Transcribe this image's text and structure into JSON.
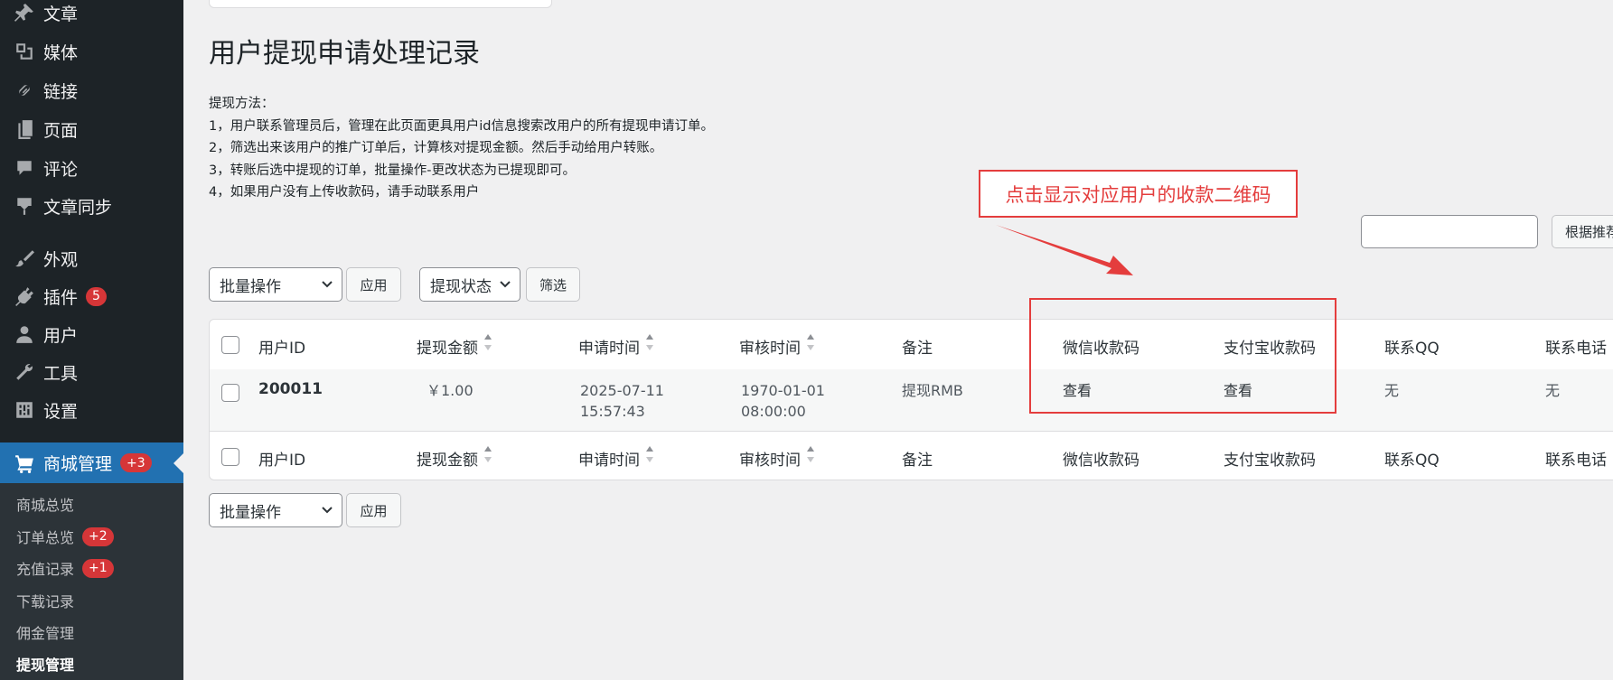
{
  "sidebar": {
    "items": [
      {
        "label": "文章",
        "icon": "pin-icon"
      },
      {
        "label": "媒体",
        "icon": "media-icon"
      },
      {
        "label": "链接",
        "icon": "link-icon"
      },
      {
        "label": "页面",
        "icon": "page-icon"
      },
      {
        "label": "评论",
        "icon": "comment-icon"
      },
      {
        "label": "文章同步",
        "icon": "sync-icon"
      },
      {
        "label": "外观",
        "icon": "brush-icon"
      },
      {
        "label": "插件",
        "icon": "plugin-icon",
        "badge": "5"
      },
      {
        "label": "用户",
        "icon": "user-icon"
      },
      {
        "label": "工具",
        "icon": "wrench-icon"
      },
      {
        "label": "设置",
        "icon": "settings-icon"
      }
    ],
    "active": {
      "label": "商城管理",
      "badge": "+3",
      "icon": "cart-icon"
    },
    "submenu": [
      {
        "label": "商城总览"
      },
      {
        "label": "订单总览",
        "badge": "+2"
      },
      {
        "label": "充值记录",
        "badge": "+1"
      },
      {
        "label": "下载记录"
      },
      {
        "label": "佣金管理"
      },
      {
        "label": "提现管理"
      }
    ]
  },
  "page": {
    "title": "用户提现申请处理记录",
    "instructions": [
      "提现方法：",
      "1，用户联系管理员后，管理在此页面更具用户id信息搜索改用户的所有提现申请订单。",
      "2，筛选出来该用户的推广订单后，计算核对提现金额。然后手动给用户转账。",
      "3，转账后选中提现的订单，批量操作-更改状态为已提现即可。",
      "4，如果用户没有上传收款码，请手动联系用户"
    ],
    "annotation": "点击显示对应用户的收款二维码",
    "search_button": "根据推荐人ID搜索"
  },
  "toolbar": {
    "bulk_action": "批量操作",
    "apply": "应用",
    "status_filter": "提现状态",
    "filter": "筛选"
  },
  "table": {
    "columns": [
      "用户ID",
      "提现金额",
      "申请时间",
      "审核时间",
      "备注",
      "微信收款码",
      "支付宝收款码",
      "联系QQ",
      "联系电话"
    ],
    "rows": [
      {
        "user_id": "200011",
        "amount": "￥1.00",
        "apply_date": "2025-07-11",
        "apply_time": "15:57:43",
        "review_date": "1970-01-01",
        "review_time": "08:00:00",
        "note": "提现RMB",
        "wechat": "查看",
        "alipay": "查看",
        "qq": "无",
        "phone": "无"
      }
    ]
  },
  "colors": {
    "sidebar_bg": "#1d2327",
    "active_bg": "#2271b1",
    "badge": "#d63638",
    "annotation": "#e43d3d"
  }
}
